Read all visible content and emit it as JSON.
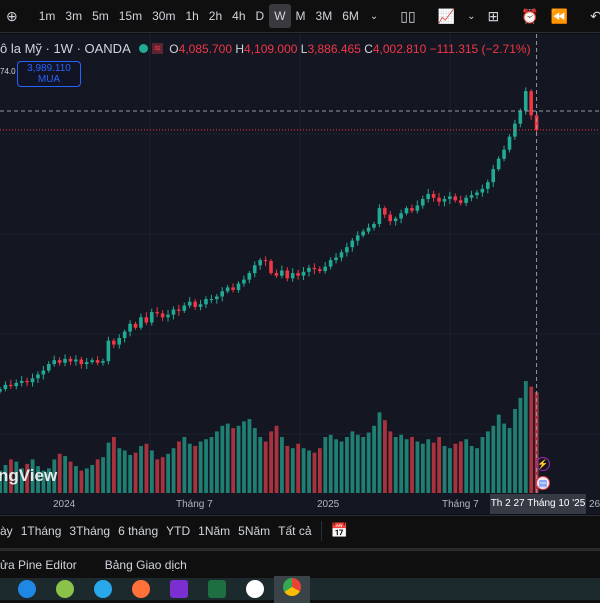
{
  "toolbar": {
    "timeframes": [
      "1m",
      "3m",
      "5m",
      "15m",
      "30m",
      "1h",
      "2h",
      "4h",
      "D",
      "W",
      "M",
      "3M",
      "6M"
    ],
    "active_timeframe": "W"
  },
  "legend": {
    "title": "ô la Mỹ · 1W · OANDA",
    "open_label": "O",
    "open": "4,085.700",
    "high_label": "H",
    "high": "4,109.000",
    "low_label": "L",
    "low": "3,886.465",
    "close_label": "C",
    "close": "4,002.810",
    "change": "−111.315 (−2.71%)"
  },
  "price_tag": "74.0",
  "buy_button": {
    "price": "3,989.110",
    "label": "MUA"
  },
  "watermark": "ngView",
  "time_axis": {
    "labels": [
      "2024",
      "Tháng 7",
      "2025",
      "Tháng 7"
    ],
    "crosshair_label": "Th 2 27 Tháng 10 '25",
    "right_label": "26"
  },
  "range_bar": {
    "items": [
      "ày",
      "1Tháng",
      "3Tháng",
      "6 tháng",
      "YTD",
      "1Năm",
      "5Năm",
      "Tất cả"
    ]
  },
  "bottom_panel": {
    "items": [
      "ửa Pine Editor",
      "Bảng Giao dịch"
    ]
  },
  "colors": {
    "up": "#22ab94",
    "down": "#f23645",
    "volume_up": "#1e7f72",
    "volume_down": "#a8323d"
  },
  "chart_data": {
    "type": "candlestick",
    "ylim": [
      1200,
      4740
    ],
    "closes": [
      2008,
      2040,
      2030,
      2055,
      2070,
      2060,
      2090,
      2120,
      2150,
      2200,
      2230,
      2210,
      2240,
      2220,
      2235,
      2200,
      2215,
      2230,
      2210,
      2223,
      2380,
      2350,
      2400,
      2450,
      2510,
      2480,
      2560,
      2520,
      2600,
      2590,
      2560,
      2580,
      2620,
      2610,
      2650,
      2680,
      2640,
      2660,
      2700,
      2700,
      2720,
      2760,
      2790,
      2770,
      2820,
      2850,
      2900,
      2960,
      3000,
      2993,
      2900,
      2880,
      2920,
      2860,
      2900,
      2880,
      2910,
      2940,
      2930,
      2916,
      2950,
      3000,
      3020,
      3060,
      3100,
      3150,
      3190,
      3220,
      3250,
      3278,
      3400,
      3350,
      3300,
      3320,
      3360,
      3400,
      3380,
      3420,
      3470,
      3509,
      3480,
      3450,
      3470,
      3490,
      3460,
      3440,
      3480,
      3500,
      3520,
      3548,
      3600,
      3700,
      3780,
      3850,
      3950,
      4050,
      4150,
      4300,
      4114,
      4002
    ],
    "volume_rel": [
      0.2,
      0.25,
      0.3,
      0.28,
      0.22,
      0.26,
      0.3,
      0.24,
      0.2,
      0.22,
      0.3,
      0.35,
      0.33,
      0.28,
      0.24,
      0.2,
      0.22,
      0.25,
      0.3,
      0.32,
      0.45,
      0.5,
      0.4,
      0.38,
      0.34,
      0.36,
      0.42,
      0.44,
      0.38,
      0.3,
      0.32,
      0.35,
      0.4,
      0.46,
      0.5,
      0.44,
      0.42,
      0.46,
      0.48,
      0.5,
      0.55,
      0.6,
      0.62,
      0.58,
      0.6,
      0.64,
      0.66,
      0.58,
      0.5,
      0.46,
      0.55,
      0.6,
      0.5,
      0.42,
      0.4,
      0.44,
      0.4,
      0.38,
      0.36,
      0.4,
      0.5,
      0.52,
      0.48,
      0.46,
      0.5,
      0.55,
      0.52,
      0.5,
      0.54,
      0.6,
      0.72,
      0.65,
      0.55,
      0.5,
      0.52,
      0.48,
      0.5,
      0.46,
      0.44,
      0.48,
      0.45,
      0.5,
      0.42,
      0.4,
      0.44,
      0.46,
      0.48,
      0.42,
      0.4,
      0.5,
      0.55,
      0.6,
      0.7,
      0.62,
      0.58,
      0.75,
      0.85,
      1.0,
      0.95,
      0.9
    ]
  }
}
